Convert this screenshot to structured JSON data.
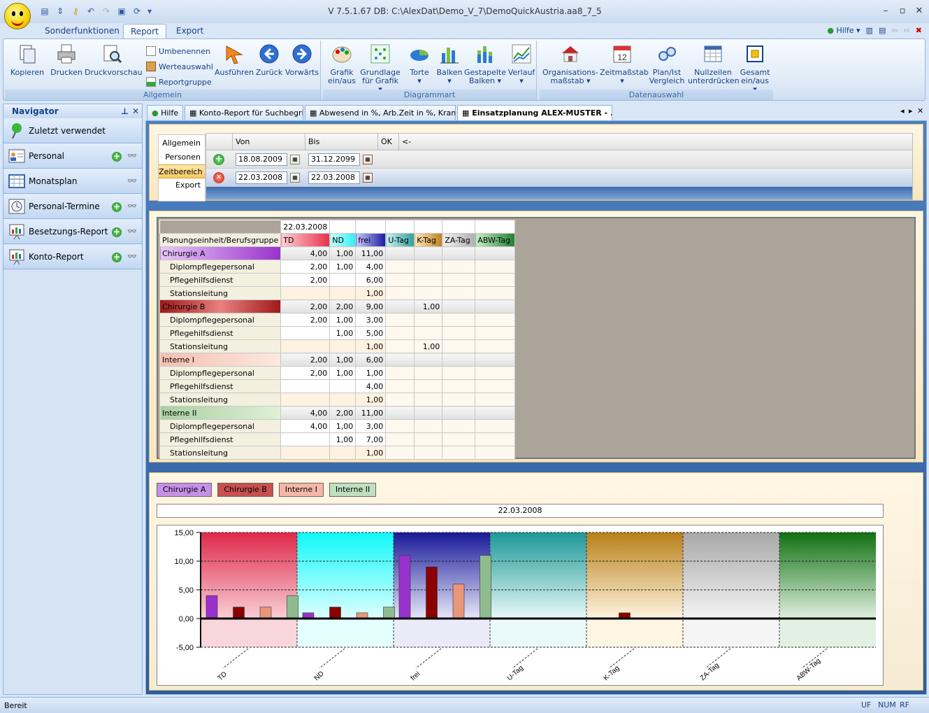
{
  "window": {
    "title": "V 7.5.1.67 DB: C:\\AlexDat\\Demo_V_7\\DemoQuickAustria.aa8_7_5"
  },
  "ribbon_tabs": [
    "Sonderfunktionen",
    "Report",
    "Export"
  ],
  "help_label": "Hilfe",
  "ribbon": {
    "allgemein": {
      "label": "Allgemein",
      "kopieren": "Kopieren",
      "drucken": "Drucken",
      "druckvorschau": "Druckvorschau",
      "umbenennen": "Umbenennen",
      "werteauswahl": "Werteauswahl",
      "reportgruppe": "Reportgruppe",
      "ausfuehren": "Ausführen",
      "zurueck": "Zurück",
      "vorwaerts": "Vorwärts"
    },
    "diagrammart": {
      "label": "Diagrammart",
      "grafik1": "Grafik",
      "grafik2": "ein/aus",
      "grundlage1": "Grundlage",
      "grundlage2": "für Grafik",
      "torte": "Torte",
      "balken": "Balken",
      "gestapelte1": "Gestapelte",
      "gestapelte2": "Balken",
      "verlauf": "Verlauf"
    },
    "datenauswahl": {
      "label": "Datenauswahl",
      "org1": "Organisations-",
      "org2": "maßstab",
      "zeit": "Zeitmaßstab",
      "plan1": "Plan/Ist",
      "plan2": "Vergleich",
      "null1": "Nullzeilen",
      "null2": "unterdrücken",
      "gesamt1": "Gesamt",
      "gesamt2": "ein/aus"
    }
  },
  "navigator": {
    "title": "Navigator",
    "recent": "Zuletzt verwendet",
    "items": [
      "Personal",
      "Monatsplan",
      "Personal-Termine",
      "Besetzungs-Report",
      "Konto-Report"
    ]
  },
  "doc_tabs": [
    "Hilfe",
    "Konto-Report für Suchbegriff",
    "Abwesend in %, Arb.Zeit in %, Kran...",
    "Einsatzplanung ALEX-MUSTER - ..."
  ],
  "side_tabs": [
    "Allgemein",
    "Personen",
    "Zeitbereich",
    "Export"
  ],
  "zeit": {
    "headers": [
      "Von",
      "Bis",
      "OK",
      "<-"
    ],
    "rows": [
      {
        "von": "18.08.2009",
        "bis": "31.12.2099"
      },
      {
        "von": "22.03.2008",
        "bis": "22.03.2008"
      }
    ]
  },
  "pivot": {
    "date": "22.03.2008",
    "rowheader": "Planungseinheit/Berufsgruppe",
    "columns": [
      "TD",
      "ND",
      "frei",
      "U-Tag",
      "K-Tag",
      "ZA-Tag",
      "ABW-Tag"
    ],
    "rows": [
      {
        "name": "Chirurgie A",
        "group": true,
        "vals": [
          "4,00",
          "1,00",
          "11,00",
          "",
          "",
          "",
          ""
        ]
      },
      {
        "name": "Diplompflegepersonal",
        "vals": [
          "2,00",
          "1,00",
          "4,00",
          "",
          "",
          "",
          ""
        ]
      },
      {
        "name": "Pflegehilfsdienst",
        "vals": [
          "2,00",
          "",
          "6,00",
          "",
          "",
          "",
          ""
        ]
      },
      {
        "name": "Stationsleitung",
        "vals": [
          "",
          "",
          "1,00",
          "",
          "",
          "",
          ""
        ]
      },
      {
        "name": "Chirurgie B",
        "group": true,
        "vals": [
          "2,00",
          "2,00",
          "9,00",
          "",
          "1,00",
          "",
          ""
        ]
      },
      {
        "name": "Diplompflegepersonal",
        "vals": [
          "2,00",
          "1,00",
          "3,00",
          "",
          "",
          "",
          ""
        ]
      },
      {
        "name": "Pflegehilfsdienst",
        "vals": [
          "",
          "1,00",
          "5,00",
          "",
          "",
          "",
          ""
        ]
      },
      {
        "name": "Stationsleitung",
        "vals": [
          "",
          "",
          "1,00",
          "",
          "1,00",
          "",
          ""
        ]
      },
      {
        "name": "Interne I",
        "group": true,
        "vals": [
          "2,00",
          "1,00",
          "6,00",
          "",
          "",
          "",
          ""
        ]
      },
      {
        "name": "Diplompflegepersonal",
        "vals": [
          "2,00",
          "1,00",
          "1,00",
          "",
          "",
          "",
          ""
        ]
      },
      {
        "name": "Pflegehilfsdienst",
        "vals": [
          "",
          "",
          "4,00",
          "",
          "",
          "",
          ""
        ]
      },
      {
        "name": "Stationsleitung",
        "vals": [
          "",
          "",
          "1,00",
          "",
          "",
          "",
          ""
        ]
      },
      {
        "name": "Interne II",
        "group": true,
        "vals": [
          "4,00",
          "2,00",
          "11,00",
          "",
          "",
          "",
          ""
        ]
      },
      {
        "name": "Diplompflegepersonal",
        "vals": [
          "4,00",
          "1,00",
          "3,00",
          "",
          "",
          "",
          ""
        ]
      },
      {
        "name": "Pflegehilfsdienst",
        "vals": [
          "",
          "1,00",
          "7,00",
          "",
          "",
          "",
          ""
        ]
      },
      {
        "name": "Stationsleitung",
        "vals": [
          "",
          "",
          "1,00",
          "",
          "",
          "",
          ""
        ]
      }
    ]
  },
  "colors": {
    "chirurgie_a": "#9932cc",
    "chirurgie_b": "#8b0000",
    "interne_i": "#e9967a",
    "interne_ii": "#8fbc8f"
  },
  "chart_data": {
    "type": "bar",
    "title": "22.03.2008",
    "categories": [
      "TD",
      "ND",
      "frei",
      "U-Tag",
      "K-Tag",
      "ZA-Tag",
      "ABW-Tag"
    ],
    "series": [
      {
        "name": "Chirurgie A",
        "values": [
          4,
          1,
          11,
          0,
          0,
          0,
          0
        ]
      },
      {
        "name": "Chirurgie B",
        "values": [
          2,
          2,
          9,
          0,
          1,
          0,
          0
        ]
      },
      {
        "name": "Interne I",
        "values": [
          2,
          1,
          6,
          0,
          0,
          0,
          0
        ]
      },
      {
        "name": "Interne II",
        "values": [
          4,
          2,
          11,
          0,
          0,
          0,
          0
        ]
      }
    ],
    "ylim": [
      -5,
      15
    ],
    "yticks": [
      "15,00",
      "10,00",
      "5,00",
      "0,00",
      "-5,00"
    ],
    "legend": "top-left",
    "grid": true
  },
  "status": {
    "text": "Bereit",
    "indicators": [
      "UF",
      "NUM",
      "RF"
    ]
  }
}
